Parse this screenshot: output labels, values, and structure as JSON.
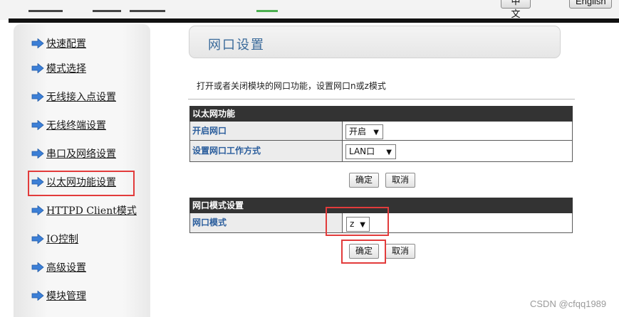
{
  "lang": {
    "chinese": "中文",
    "english": "English"
  },
  "colors": {
    "accent": "#3a6a9a",
    "label_blue": "#2a5d9c",
    "highlight_red": "#e23b3b",
    "header_bg": "#333333"
  },
  "sidebar": {
    "items": [
      {
        "label": "快速配置",
        "icon": "arrow-right-icon"
      },
      {
        "label": "模式选择",
        "icon": "arrow-right-icon"
      },
      {
        "label": "无线接入点设置",
        "icon": "arrow-right-icon"
      },
      {
        "label": "无线终端设置",
        "icon": "arrow-right-icon"
      },
      {
        "label": "串口及网络设置",
        "icon": "arrow-right-icon"
      },
      {
        "label": "以太网功能设置",
        "icon": "arrow-right-icon",
        "active": true
      },
      {
        "label": "HTTPD Client模式",
        "icon": "arrow-right-icon"
      },
      {
        "label": "IO控制",
        "icon": "arrow-right-icon"
      },
      {
        "label": "高级设置",
        "icon": "arrow-right-icon"
      },
      {
        "label": "模块管理",
        "icon": "arrow-right-icon"
      }
    ]
  },
  "main": {
    "title": "网口设置",
    "description": "打开或者关闭模块的网口功能，设置网口n或z模式",
    "ethernet": {
      "header": "以太网功能",
      "rows": [
        {
          "label": "开启网口",
          "value": "开启"
        },
        {
          "label": "设置网口工作方式",
          "value": "LAN口"
        }
      ],
      "confirm": "确定",
      "cancel": "取消"
    },
    "port_mode": {
      "header": "网口模式设置",
      "rows": [
        {
          "label": "网口模式",
          "value": "z"
        }
      ],
      "confirm": "确定",
      "cancel": "取消"
    }
  },
  "watermark": "CSDN @cfqq1989"
}
